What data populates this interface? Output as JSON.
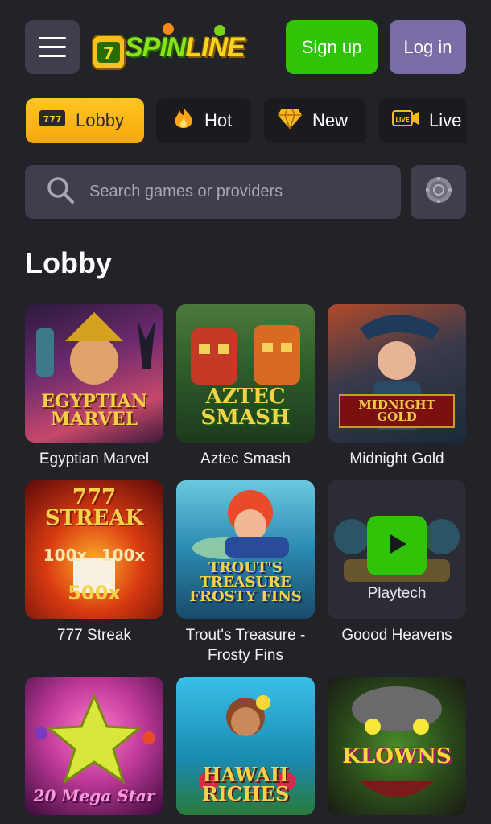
{
  "header": {
    "logo_text": "SPIN LINE",
    "logo_part1": "SPIN",
    "logo_part2": "LINE",
    "signup_label": "Sign up",
    "login_label": "Log in"
  },
  "tabs": [
    {
      "label": "Lobby",
      "icon": "777-slot-icon",
      "active": true
    },
    {
      "label": "Hot",
      "icon": "fire-icon",
      "active": false
    },
    {
      "label": "New",
      "icon": "diamond-icon",
      "active": false
    },
    {
      "label": "Live",
      "icon": "live-camera-icon",
      "active": false
    }
  ],
  "search": {
    "placeholder": "Search games or providers"
  },
  "lobby": {
    "title": "Lobby",
    "games": [
      {
        "name": "Egyptian Marvel",
        "art_text": "EGYPTIAN MARVEL"
      },
      {
        "name": "Aztec Smash",
        "art_text": "AZTEC SMASH"
      },
      {
        "name": "Midnight Gold",
        "art_text": "MIDNIGHT GOLD"
      },
      {
        "name": "777 Streak",
        "art_text": "777 STREAK"
      },
      {
        "name": "Trout's Treasure - Frosty Fins",
        "art_text": "TROUT'S TREASURE FROSTY FINS"
      },
      {
        "name": "Goood Heavens",
        "provider": "Playtech"
      },
      {
        "name": "20 Mega Star",
        "art_text": "20 Mega Star"
      },
      {
        "name": "Hawaii Riches",
        "art_text": "HAWAII RICHES"
      },
      {
        "name": "Klowns",
        "art_text": "KLOWNS"
      }
    ]
  },
  "colors": {
    "background": "#222229",
    "accent_green": "#2fc408",
    "login_purple": "#7c6ca6",
    "active_tab": "#ffc61e"
  }
}
